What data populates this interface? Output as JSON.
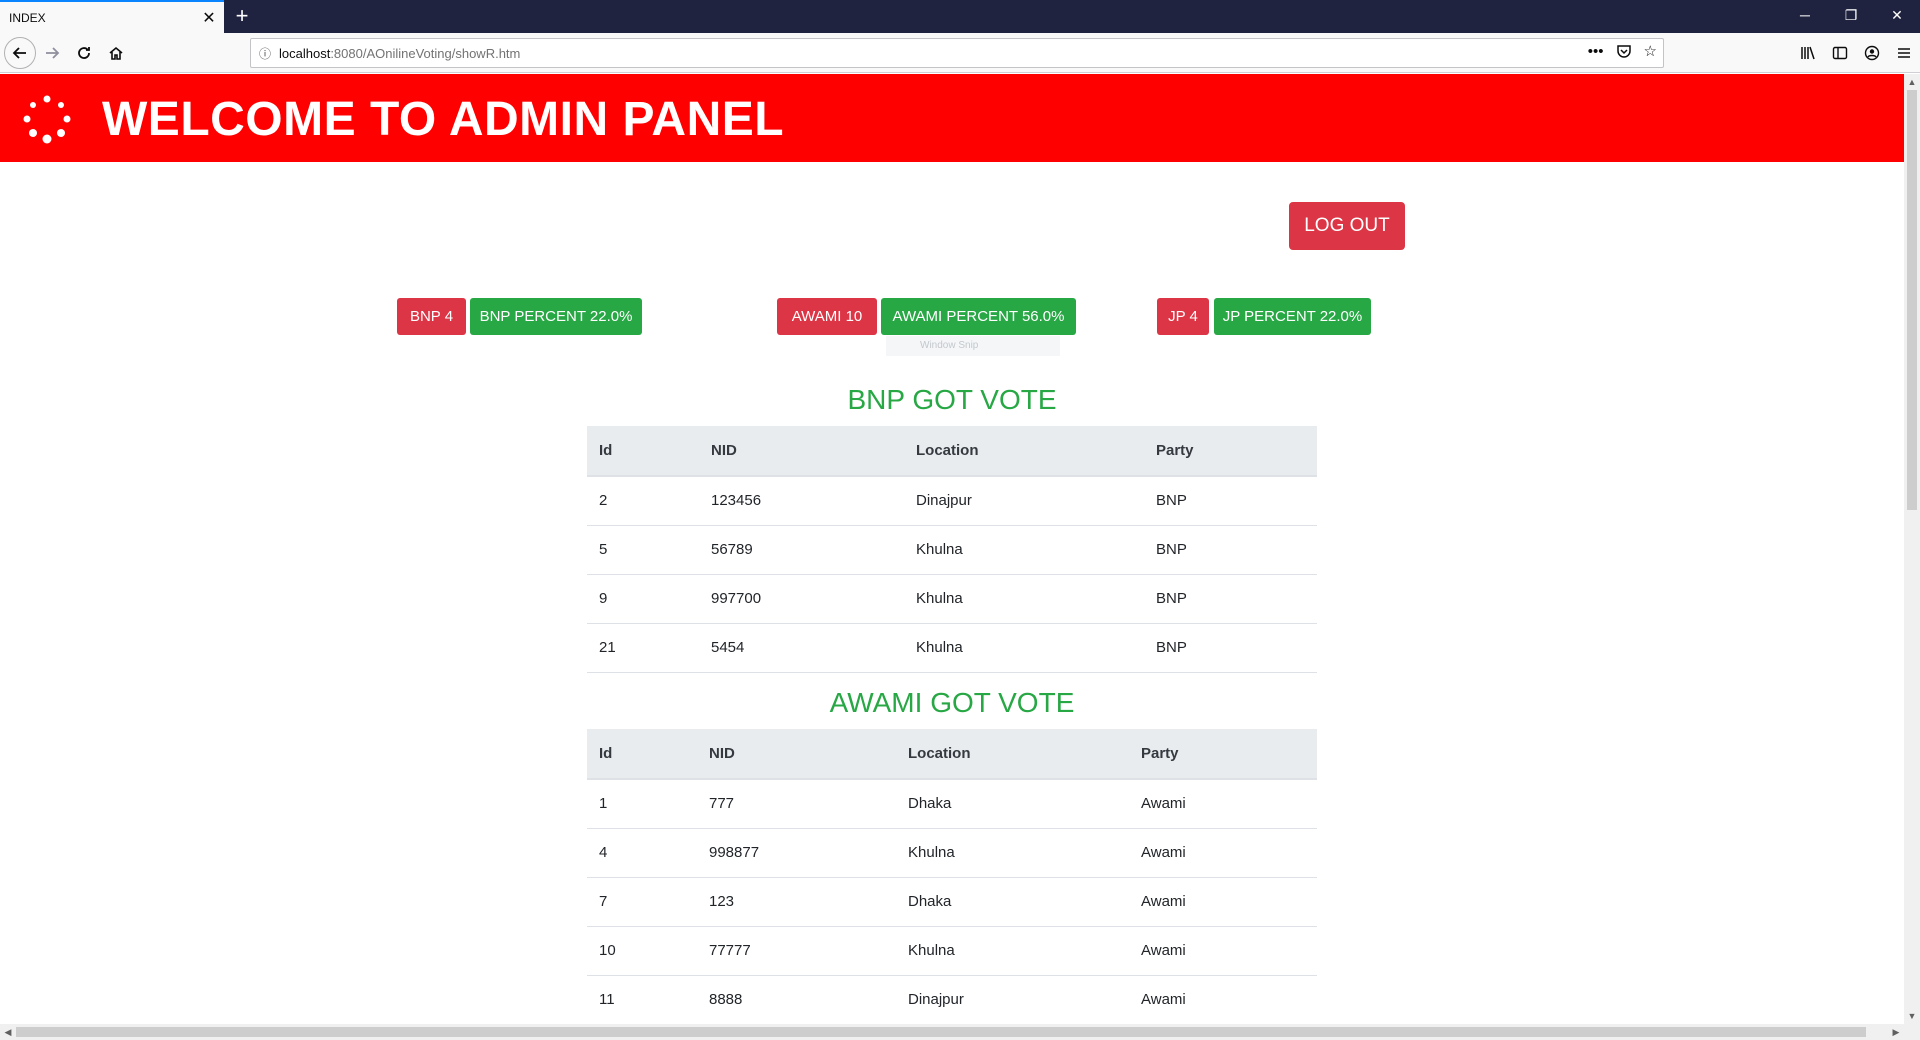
{
  "browser": {
    "tab_title": "INDEX",
    "tab_close": "✕",
    "new_tab": "+",
    "url_host": "localhost",
    "url_path": ":8080/AOnilineVoting/showR.htm",
    "window_minimize": "─",
    "window_restore": "❐",
    "window_close": "✕"
  },
  "header": {
    "title": "WELCOME TO ADMIN PANEL",
    "bg_color": "#ff0000"
  },
  "actions": {
    "logout_label": "LOG OUT"
  },
  "results": [
    {
      "count_label": "BNP 4",
      "percent_label": "BNP PERCENT 22.0%"
    },
    {
      "count_label": "AWAMI 10",
      "percent_label": "AWAMI PERCENT 56.0%"
    },
    {
      "count_label": "JP 4",
      "percent_label": "JP PERCENT 22.0%"
    }
  ],
  "overlay": {
    "snip_label": "Window Snip"
  },
  "bnp": {
    "title": "BNP GOT VOTE",
    "columns": [
      "Id",
      "NID",
      "Location",
      "Party"
    ],
    "rows": [
      [
        "2",
        "123456",
        "Dinajpur",
        "BNP"
      ],
      [
        "5",
        "56789",
        "Khulna",
        "BNP"
      ],
      [
        "9",
        "997700",
        "Khulna",
        "BNP"
      ],
      [
        "21",
        "5454",
        "Khulna",
        "BNP"
      ]
    ]
  },
  "awami": {
    "title": "AWAMI GOT VOTE",
    "columns": [
      "Id",
      "NID",
      "Location",
      "Party"
    ],
    "rows": [
      [
        "1",
        "777",
        "Dhaka",
        "Awami"
      ],
      [
        "4",
        "998877",
        "Khulna",
        "Awami"
      ],
      [
        "7",
        "123",
        "Dhaka",
        "Awami"
      ],
      [
        "10",
        "77777",
        "Khulna",
        "Awami"
      ],
      [
        "11",
        "8888",
        "Dinajpur",
        "Awami"
      ]
    ]
  },
  "colors": {
    "danger": "#dc3545",
    "success": "#28a745",
    "title_green": "#28a745"
  }
}
